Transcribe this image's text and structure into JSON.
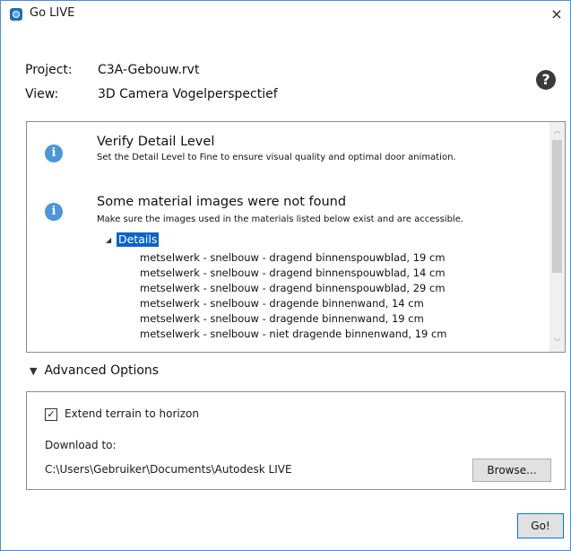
{
  "window": {
    "title": "Go LIVE",
    "close_glyph": "×"
  },
  "project": {
    "label": "Project:",
    "value": "C3A-Gebouw.rvt"
  },
  "view": {
    "label": "View:",
    "value": "3D Camera Vogelperspectief"
  },
  "help": {
    "glyph": "?"
  },
  "messages": [
    {
      "icon": "info-icon",
      "title": "Verify Detail Level",
      "description": "Set the Detail Level to Fine to ensure visual quality and optimal door animation."
    },
    {
      "icon": "info-icon",
      "title": "Some material images were not found",
      "description": "Make sure the images used in the materials listed below exist and are accessible."
    }
  ],
  "details": {
    "label": "Details",
    "items": [
      "metselwerk - snelbouw - dragend binnenspouwblad, 19 cm",
      "metselwerk - snelbouw - dragend binnenspouwblad, 14 cm",
      "metselwerk - snelbouw - dragend binnenspouwblad, 29 cm",
      "metselwerk - snelbouw - dragende binnenwand, 14 cm",
      "metselwerk - snelbouw - dragende binnenwand, 19 cm",
      "metselwerk - snelbouw - niet dragende binnenwand, 19 cm"
    ]
  },
  "advanced": {
    "label": "Advanced Options",
    "extend_terrain_label": "Extend terrain to horizon",
    "extend_terrain_checked": true,
    "download_label": "Download to:",
    "download_path": "C:\\Users\\Gebruiker\\Documents\\Autodesk LIVE",
    "browse_label": "Browse..."
  },
  "go_label": "Go!",
  "colors": {
    "window_border": "#4a90d9",
    "info_blue": "#4a96d9",
    "selection": "#0a64c8"
  }
}
